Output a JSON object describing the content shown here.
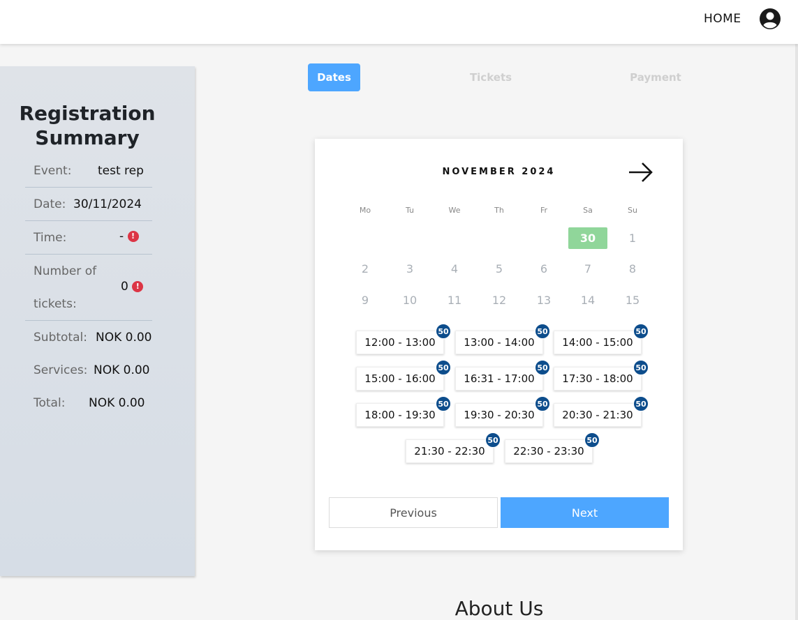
{
  "nav": {
    "home": "HOME"
  },
  "steps": {
    "dates": "Dates",
    "tickets": "Tickets",
    "payment": "Payment"
  },
  "summary": {
    "title": "Registration Summary",
    "event_label": "Event:",
    "event_value": "test rep",
    "date_label": "Date:",
    "date_value": "30/11/2024",
    "time_label": "Time:",
    "time_value": "-",
    "tickets_label_1": "Number of",
    "tickets_label_2": "tickets:",
    "tickets_value": "0",
    "subtotal_label": "Subtotal:",
    "subtotal_value": "NOK 0.00",
    "services_label": "Services:",
    "services_value": "NOK 0.00",
    "total_label": "Total:",
    "total_value": "NOK 0.00",
    "warning_glyph": "!"
  },
  "calendar": {
    "month": "NOVEMBER 2024",
    "weekdays": [
      "Mo",
      "Tu",
      "We",
      "Th",
      "Fr",
      "Sa",
      "Su"
    ],
    "week1": [
      "30",
      "1"
    ],
    "week2": [
      "2",
      "3",
      "4",
      "5",
      "6",
      "7",
      "8"
    ],
    "week3": [
      "9",
      "10",
      "11",
      "12",
      "13",
      "14",
      "15"
    ],
    "selected_day": "30",
    "selected_color": "#90d69a"
  },
  "slots": [
    {
      "time": "12:00 - 13:00",
      "count": "50"
    },
    {
      "time": "13:00 - 14:00",
      "count": "50"
    },
    {
      "time": "14:00 - 15:00",
      "count": "50"
    },
    {
      "time": "15:00 - 16:00",
      "count": "50"
    },
    {
      "time": "16:31 - 17:00",
      "count": "50"
    },
    {
      "time": "17:30 - 18:00",
      "count": "50"
    },
    {
      "time": "18:00 - 19:30",
      "count": "50"
    },
    {
      "time": "19:30 - 20:30",
      "count": "50"
    },
    {
      "time": "20:30 - 21:30",
      "count": "50"
    },
    {
      "time": "21:30 - 22:30",
      "count": "50"
    },
    {
      "time": "22:30 - 23:30",
      "count": "50"
    }
  ],
  "buttons": {
    "previous": "Previous",
    "next": "Next"
  },
  "footer": {
    "about": "About Us"
  },
  "colors": {
    "accent": "#4da6ff",
    "badge": "#0d4d8c",
    "warning": "#dc3545"
  }
}
